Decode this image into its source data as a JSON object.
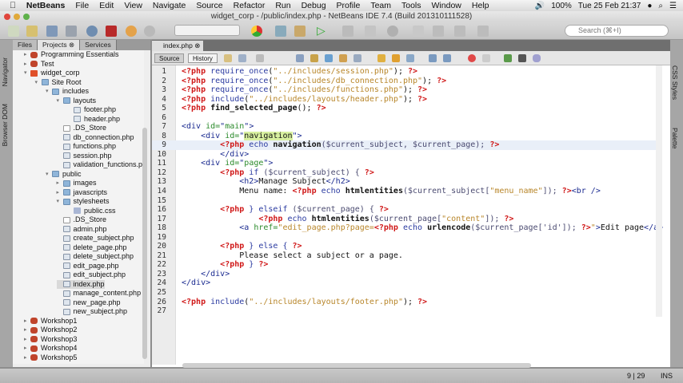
{
  "menubar": {
    "app": "NetBeans",
    "items": [
      "File",
      "Edit",
      "View",
      "Navigate",
      "Source",
      "Refactor",
      "Run",
      "Debug",
      "Profile",
      "Team",
      "Tools",
      "Window",
      "Help"
    ],
    "battery": "100%",
    "clock": "Tue 25 Feb  21:37"
  },
  "window": {
    "title": "widget_corp - /public/index.php - NetBeans IDE 7.4 (Build 201310111528)"
  },
  "toolbar": {
    "search_placeholder": "Search (⌘+I)"
  },
  "sidestrip": {
    "left": [
      "Navigator",
      "Browser DOM"
    ],
    "right": [
      "CSS Styles",
      "Palette"
    ]
  },
  "panel": {
    "tabs": [
      "Files",
      "Projects",
      "Services"
    ],
    "active_tab": "Projects"
  },
  "tree": [
    {
      "label": "Programming Essentials",
      "depth": 0,
      "type": "proj",
      "tw": "▸"
    },
    {
      "label": "Test",
      "depth": 0,
      "type": "proj",
      "tw": "▸"
    },
    {
      "label": "widget_corp",
      "depth": 0,
      "type": "h5",
      "tw": "▾"
    },
    {
      "label": "Site Root",
      "depth": 1,
      "type": "folder",
      "tw": "▾"
    },
    {
      "label": "includes",
      "depth": 2,
      "type": "folder",
      "tw": "▾"
    },
    {
      "label": "layouts",
      "depth": 3,
      "type": "folder",
      "tw": "▾"
    },
    {
      "label": "footer.php",
      "depth": 4,
      "type": "file",
      "tw": ""
    },
    {
      "label": "header.php",
      "depth": 4,
      "type": "file",
      "tw": ""
    },
    {
      "label": ".DS_Store",
      "depth": 3,
      "type": "blank",
      "tw": ""
    },
    {
      "label": "db_connection.php",
      "depth": 3,
      "type": "file",
      "tw": ""
    },
    {
      "label": "functions.php",
      "depth": 3,
      "type": "file",
      "tw": ""
    },
    {
      "label": "session.php",
      "depth": 3,
      "type": "file",
      "tw": ""
    },
    {
      "label": "validation_functions.php",
      "depth": 3,
      "type": "file",
      "tw": ""
    },
    {
      "label": "public",
      "depth": 2,
      "type": "folder",
      "tw": "▾"
    },
    {
      "label": "images",
      "depth": 3,
      "type": "folder",
      "tw": "▸"
    },
    {
      "label": "javascripts",
      "depth": 3,
      "type": "folder",
      "tw": "▸"
    },
    {
      "label": "stylesheets",
      "depth": 3,
      "type": "folder",
      "tw": "▾"
    },
    {
      "label": "public.css",
      "depth": 4,
      "type": "css",
      "tw": ""
    },
    {
      "label": ".DS_Store",
      "depth": 3,
      "type": "blank",
      "tw": ""
    },
    {
      "label": "admin.php",
      "depth": 3,
      "type": "file",
      "tw": ""
    },
    {
      "label": "create_subject.php",
      "depth": 3,
      "type": "file",
      "tw": ""
    },
    {
      "label": "delete_page.php",
      "depth": 3,
      "type": "file",
      "tw": ""
    },
    {
      "label": "delete_subject.php",
      "depth": 3,
      "type": "file",
      "tw": ""
    },
    {
      "label": "edit_page.php",
      "depth": 3,
      "type": "file",
      "tw": ""
    },
    {
      "label": "edit_subject.php",
      "depth": 3,
      "type": "file",
      "tw": ""
    },
    {
      "label": "index.php",
      "depth": 3,
      "type": "file",
      "tw": "",
      "selected": true
    },
    {
      "label": "manage_content.php",
      "depth": 3,
      "type": "file",
      "tw": ""
    },
    {
      "label": "new_page.php",
      "depth": 3,
      "type": "file",
      "tw": ""
    },
    {
      "label": "new_subject.php",
      "depth": 3,
      "type": "file",
      "tw": ""
    },
    {
      "label": "Workshop1",
      "depth": 0,
      "type": "proj",
      "tw": "▸"
    },
    {
      "label": "Workshop2",
      "depth": 0,
      "type": "proj",
      "tw": "▸"
    },
    {
      "label": "Workshop3",
      "depth": 0,
      "type": "proj",
      "tw": "▸"
    },
    {
      "label": "Workshop4",
      "depth": 0,
      "type": "proj",
      "tw": "▸"
    },
    {
      "label": "Workshop5",
      "depth": 0,
      "type": "proj",
      "tw": "▸"
    }
  ],
  "editor": {
    "tab": "index.php",
    "source_label": "Source",
    "history_label": "History",
    "current_line": 9,
    "lines": [
      {
        "n": "1",
        "tok": [
          [
            "t",
            "<?php "
          ],
          [
            "f",
            "require_once"
          ],
          [
            "p",
            "("
          ],
          [
            "s",
            "\"../includes/session.php\""
          ],
          [
            "p",
            "); "
          ],
          [
            "t",
            "?>"
          ]
        ]
      },
      {
        "n": "2",
        "tok": [
          [
            "t",
            "<?php "
          ],
          [
            "f",
            "require_once"
          ],
          [
            "p",
            "("
          ],
          [
            "s",
            "\"../includes/db_connection.php\""
          ],
          [
            "p",
            "); "
          ],
          [
            "t",
            "?>"
          ]
        ]
      },
      {
        "n": "3",
        "tok": [
          [
            "t",
            "<?php "
          ],
          [
            "f",
            "require_once"
          ],
          [
            "p",
            "("
          ],
          [
            "s",
            "\"../includes/functions.php\""
          ],
          [
            "p",
            "); "
          ],
          [
            "t",
            "?>"
          ]
        ]
      },
      {
        "n": "4",
        "tok": [
          [
            "t",
            "<?php "
          ],
          [
            "f",
            "include"
          ],
          [
            "p",
            "("
          ],
          [
            "s",
            "\"../includes/layouts/header.php\""
          ],
          [
            "p",
            "); "
          ],
          [
            "t",
            "?>"
          ]
        ]
      },
      {
        "n": "5",
        "tok": [
          [
            "t",
            "<?php "
          ],
          [
            "b",
            "find_selected_page"
          ],
          [
            "p",
            "(); "
          ],
          [
            "t",
            "?>"
          ]
        ]
      },
      {
        "n": "6",
        "tok": []
      },
      {
        "n": "7",
        "tok": [
          [
            "h",
            "<div "
          ],
          [
            "a",
            "id="
          ],
          [
            "h",
            "\""
          ],
          [
            "a",
            "main"
          ],
          [
            "h",
            "\">"
          ]
        ]
      },
      {
        "n": "8",
        "tok": [
          [
            "p",
            "    "
          ],
          [
            "h",
            "<div "
          ],
          [
            "a",
            "id="
          ],
          [
            "h",
            "\""
          ],
          [
            "hl",
            "navigation"
          ],
          [
            "h",
            "\">"
          ]
        ]
      },
      {
        "n": "9",
        "tok": [
          [
            "p",
            "        "
          ],
          [
            "t",
            "<?php "
          ],
          [
            "f",
            "echo "
          ],
          [
            "b",
            "navigation"
          ],
          [
            "v",
            "($current_subject, $current_page); "
          ],
          [
            "t",
            "?>"
          ]
        ]
      },
      {
        "n": "10",
        "tok": [
          [
            "p",
            "        "
          ],
          [
            "h",
            "</div>"
          ]
        ]
      },
      {
        "n": "11",
        "tok": [
          [
            "p",
            "    "
          ],
          [
            "h",
            "<div "
          ],
          [
            "a",
            "id="
          ],
          [
            "h",
            "\""
          ],
          [
            "a",
            "page"
          ],
          [
            "h",
            "\">"
          ]
        ]
      },
      {
        "n": "12",
        "tok": [
          [
            "p",
            "        "
          ],
          [
            "t",
            "<?php "
          ],
          [
            "f",
            "if "
          ],
          [
            "v",
            "($current_subject) { "
          ],
          [
            "t",
            "?>"
          ]
        ]
      },
      {
        "n": "13",
        "tok": [
          [
            "p",
            "            "
          ],
          [
            "h",
            "<h2>"
          ],
          [
            "p",
            "Manage Subject"
          ],
          [
            "h",
            "</h2>"
          ]
        ]
      },
      {
        "n": "14",
        "tok": [
          [
            "p",
            "            Menu name: "
          ],
          [
            "t",
            "<?php "
          ],
          [
            "f",
            "echo "
          ],
          [
            "b",
            "htmlentities"
          ],
          [
            "v",
            "($current_subject["
          ],
          [
            "s",
            "\"menu_name\""
          ],
          [
            "v",
            "]); "
          ],
          [
            "t",
            "?>"
          ],
          [
            "h",
            "<br />"
          ]
        ]
      },
      {
        "n": "15",
        "tok": []
      },
      {
        "n": "16",
        "tok": [
          [
            "p",
            "        "
          ],
          [
            "t",
            "<?php "
          ],
          [
            "f",
            "} elseif "
          ],
          [
            "v",
            "($current_page) { "
          ],
          [
            "t",
            "?>"
          ]
        ]
      },
      {
        "n": "17",
        "tok": [
          [
            "p",
            "                "
          ],
          [
            "t",
            "<?php "
          ],
          [
            "f",
            "echo "
          ],
          [
            "b",
            "htmlentities"
          ],
          [
            "v",
            "($current_page["
          ],
          [
            "s",
            "\"content\""
          ],
          [
            "v",
            "]); "
          ],
          [
            "t",
            "?>"
          ]
        ]
      },
      {
        "n": "18",
        "tok": [
          [
            "p",
            "            "
          ],
          [
            "h",
            "<a "
          ],
          [
            "a",
            "href="
          ],
          [
            "s",
            "\"edit_page.php?page="
          ],
          [
            "t",
            "<?php "
          ],
          [
            "f",
            "echo "
          ],
          [
            "b",
            "urlencode"
          ],
          [
            "v",
            "($current_page['id']); "
          ],
          [
            "t",
            "?>"
          ],
          [
            "s",
            "\""
          ],
          [
            "h",
            ">"
          ],
          [
            "p",
            "Edit page"
          ],
          [
            "h",
            "</a>"
          ]
        ]
      },
      {
        "n": "19",
        "tok": []
      },
      {
        "n": "20",
        "tok": [
          [
            "p",
            "        "
          ],
          [
            "t",
            "<?php "
          ],
          [
            "f",
            "} else { "
          ],
          [
            "t",
            "?>"
          ]
        ]
      },
      {
        "n": "21",
        "tok": [
          [
            "p",
            "            Please select a subject or a page."
          ]
        ]
      },
      {
        "n": "22",
        "tok": [
          [
            "p",
            "        "
          ],
          [
            "t",
            "<?php "
          ],
          [
            "f",
            "} "
          ],
          [
            "t",
            "?>"
          ]
        ]
      },
      {
        "n": "23",
        "tok": [
          [
            "p",
            "    "
          ],
          [
            "h",
            "</div>"
          ]
        ]
      },
      {
        "n": "24",
        "tok": [
          [
            "h",
            "</div>"
          ]
        ]
      },
      {
        "n": "25",
        "tok": []
      },
      {
        "n": "26",
        "tok": [
          [
            "t",
            "<?php "
          ],
          [
            "f",
            "include"
          ],
          [
            "p",
            "("
          ],
          [
            "s",
            "\"../includes/layouts/footer.php\""
          ],
          [
            "p",
            "); "
          ],
          [
            "t",
            "?>"
          ]
        ]
      },
      {
        "n": "27",
        "tok": []
      }
    ]
  },
  "status": {
    "position": "9 | 29",
    "mode": "INS"
  }
}
